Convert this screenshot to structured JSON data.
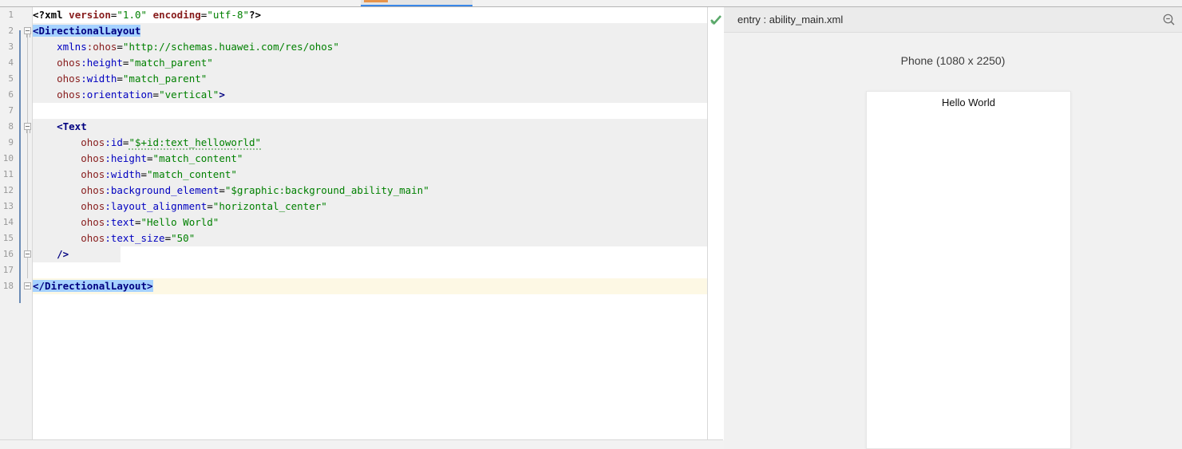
{
  "tab_strip": {
    "active_tab_name": "ability_main.xml",
    "accent_color": "#3a87e8",
    "modified_marker_color": "#e8944a"
  },
  "editor": {
    "inspection_icon": "green-check-icon",
    "inspection_status": "no-problems",
    "line_numbers": [
      "1",
      "2",
      "3",
      "4",
      "5",
      "6",
      "7",
      "8",
      "9",
      "10",
      "11",
      "12",
      "13",
      "14",
      "15",
      "16",
      "17",
      "18"
    ],
    "lines": [
      {
        "number": "1",
        "highlight": "none",
        "tokens": [
          {
            "text": "<?",
            "cls": "tok-decl"
          },
          {
            "text": "xml",
            "cls": "tok-decl"
          },
          {
            "text": " ",
            "cls": "tok-plain"
          },
          {
            "text": "version",
            "cls": "tok-declattr"
          },
          {
            "text": "=",
            "cls": "tok-punct"
          },
          {
            "text": "\"1.0\"",
            "cls": "tok-val"
          },
          {
            "text": " ",
            "cls": "tok-plain"
          },
          {
            "text": "encoding",
            "cls": "tok-declattr"
          },
          {
            "text": "=",
            "cls": "tok-punct"
          },
          {
            "text": "\"utf-8\"",
            "cls": "tok-val"
          },
          {
            "text": "?>",
            "cls": "tok-decl"
          }
        ]
      },
      {
        "number": "2",
        "highlight": "block",
        "tokens": [
          {
            "text": "<DirectionalLayout",
            "cls": "tok-tag sel-blue"
          }
        ]
      },
      {
        "number": "3",
        "highlight": "block",
        "tokens": [
          {
            "text": "    ",
            "cls": "tok-plain"
          },
          {
            "text": "xmlns",
            "cls": "tok-attr"
          },
          {
            "text": ":ohos",
            "cls": "tok-ns"
          },
          {
            "text": "=",
            "cls": "tok-punct"
          },
          {
            "text": "\"http://schemas.huawei.com/res/ohos\"",
            "cls": "tok-val"
          }
        ]
      },
      {
        "number": "4",
        "highlight": "block",
        "tokens": [
          {
            "text": "    ",
            "cls": "tok-plain"
          },
          {
            "text": "ohos",
            "cls": "tok-ns"
          },
          {
            "text": ":height",
            "cls": "tok-attr"
          },
          {
            "text": "=",
            "cls": "tok-punct"
          },
          {
            "text": "\"match_parent\"",
            "cls": "tok-val"
          }
        ]
      },
      {
        "number": "5",
        "highlight": "block",
        "tokens": [
          {
            "text": "    ",
            "cls": "tok-plain"
          },
          {
            "text": "ohos",
            "cls": "tok-ns"
          },
          {
            "text": ":width",
            "cls": "tok-attr"
          },
          {
            "text": "=",
            "cls": "tok-punct"
          },
          {
            "text": "\"match_parent\"",
            "cls": "tok-val"
          }
        ]
      },
      {
        "number": "6",
        "highlight": "block",
        "tokens": [
          {
            "text": "    ",
            "cls": "tok-plain"
          },
          {
            "text": "ohos",
            "cls": "tok-ns"
          },
          {
            "text": ":orientation",
            "cls": "tok-attr"
          },
          {
            "text": "=",
            "cls": "tok-punct"
          },
          {
            "text": "\"vertical\"",
            "cls": "tok-val"
          },
          {
            "text": ">",
            "cls": "tok-tag"
          }
        ]
      },
      {
        "number": "7",
        "highlight": "none",
        "tokens": []
      },
      {
        "number": "8",
        "highlight": "block",
        "tokens": [
          {
            "text": "    ",
            "cls": "tok-plain"
          },
          {
            "text": "<Text",
            "cls": "tok-tag"
          }
        ]
      },
      {
        "number": "9",
        "highlight": "block",
        "tokens": [
          {
            "text": "        ",
            "cls": "tok-plain"
          },
          {
            "text": "ohos",
            "cls": "tok-ns"
          },
          {
            "text": ":id",
            "cls": "tok-attr"
          },
          {
            "text": "=",
            "cls": "tok-punct"
          },
          {
            "text": "\"$+id:text_helloworld\"",
            "cls": "tok-val squiggle"
          }
        ]
      },
      {
        "number": "10",
        "highlight": "block",
        "tokens": [
          {
            "text": "        ",
            "cls": "tok-plain"
          },
          {
            "text": "ohos",
            "cls": "tok-ns"
          },
          {
            "text": ":height",
            "cls": "tok-attr"
          },
          {
            "text": "=",
            "cls": "tok-punct"
          },
          {
            "text": "\"match_content\"",
            "cls": "tok-val"
          }
        ]
      },
      {
        "number": "11",
        "highlight": "block",
        "tokens": [
          {
            "text": "        ",
            "cls": "tok-plain"
          },
          {
            "text": "ohos",
            "cls": "tok-ns"
          },
          {
            "text": ":width",
            "cls": "tok-attr"
          },
          {
            "text": "=",
            "cls": "tok-punct"
          },
          {
            "text": "\"match_content\"",
            "cls": "tok-val"
          }
        ]
      },
      {
        "number": "12",
        "highlight": "block",
        "tokens": [
          {
            "text": "        ",
            "cls": "tok-plain"
          },
          {
            "text": "ohos",
            "cls": "tok-ns"
          },
          {
            "text": ":background_element",
            "cls": "tok-attr"
          },
          {
            "text": "=",
            "cls": "tok-punct"
          },
          {
            "text": "\"$graphic:background_ability_main\"",
            "cls": "tok-val"
          }
        ]
      },
      {
        "number": "13",
        "highlight": "block",
        "tokens": [
          {
            "text": "        ",
            "cls": "tok-plain"
          },
          {
            "text": "ohos",
            "cls": "tok-ns"
          },
          {
            "text": ":layout_alignment",
            "cls": "tok-attr"
          },
          {
            "text": "=",
            "cls": "tok-punct"
          },
          {
            "text": "\"horizontal_center\"",
            "cls": "tok-val"
          }
        ]
      },
      {
        "number": "14",
        "highlight": "block",
        "tokens": [
          {
            "text": "        ",
            "cls": "tok-plain"
          },
          {
            "text": "ohos",
            "cls": "tok-ns"
          },
          {
            "text": ":text",
            "cls": "tok-attr"
          },
          {
            "text": "=",
            "cls": "tok-punct"
          },
          {
            "text": "\"Hello World\"",
            "cls": "tok-val"
          }
        ]
      },
      {
        "number": "15",
        "highlight": "block",
        "tokens": [
          {
            "text": "        ",
            "cls": "tok-plain"
          },
          {
            "text": "ohos",
            "cls": "tok-ns"
          },
          {
            "text": ":text_size",
            "cls": "tok-attr"
          },
          {
            "text": "=",
            "cls": "tok-punct"
          },
          {
            "text": "\"50\"",
            "cls": "tok-val"
          }
        ]
      },
      {
        "number": "16",
        "highlight": "block-short",
        "tokens": [
          {
            "text": "    ",
            "cls": "tok-plain"
          },
          {
            "text": "/>",
            "cls": "tok-tag"
          }
        ]
      },
      {
        "number": "17",
        "highlight": "none",
        "tokens": []
      },
      {
        "number": "18",
        "highlight": "caret",
        "tokens": [
          {
            "text": "</DirectionalLayout>",
            "cls": "tok-tag sel-blue"
          }
        ]
      }
    ]
  },
  "preview": {
    "header_title": "entry : ability_main.xml",
    "zoom_out_icon": "magnifier-minus-icon",
    "device_label": "Phone (1080 x 2250)",
    "device_screen_text": "Hello World"
  }
}
